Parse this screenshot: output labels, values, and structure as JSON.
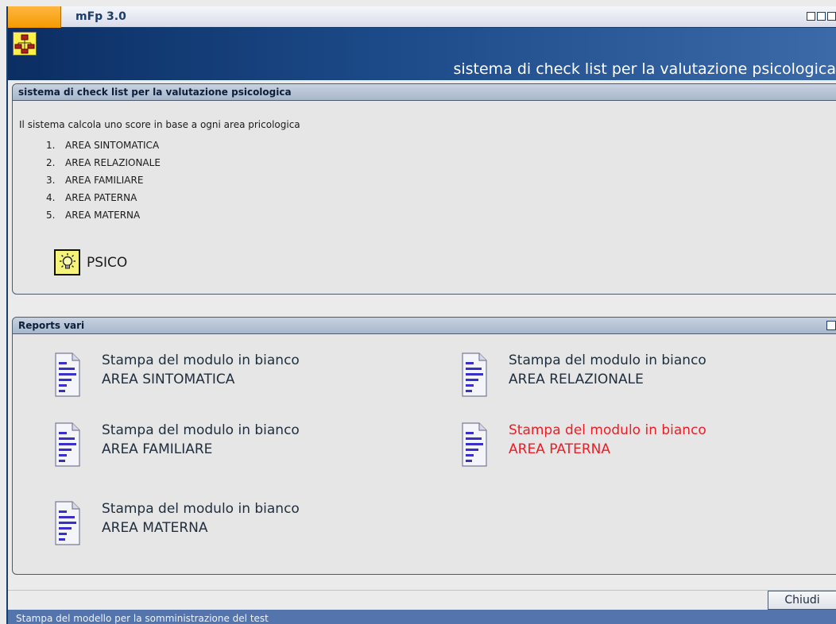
{
  "window": {
    "title": "mFp 3.0"
  },
  "banner": {
    "title": "sistema di check list per la valutazione psicologica"
  },
  "panel1": {
    "header": "sistema di check list per la valutazione psicologica",
    "intro": "Il sistema calcola uno score in base a ogni area pricologica",
    "areas": [
      {
        "num": "1.",
        "label": "AREA SINTOMATICA"
      },
      {
        "num": "2.",
        "label": "AREA RELAZIONALE"
      },
      {
        "num": "3.",
        "label": "AREA FAMILIARE"
      },
      {
        "num": "4.",
        "label": "AREA PATERNA"
      },
      {
        "num": "5.",
        "label": "AREA MATERNA"
      }
    ],
    "psico_label": "PSICO"
  },
  "panel2": {
    "header": "Reports vari",
    "reports": [
      {
        "line1": "Stampa del modulo in bianco",
        "line2": "AREA SINTOMATICA",
        "highlighted": false
      },
      {
        "line1": "Stampa del modulo in bianco",
        "line2": "AREA RELAZIONALE",
        "highlighted": false
      },
      {
        "line1": "Stampa del modulo in bianco",
        "line2": "AREA FAMILIARE",
        "highlighted": false
      },
      {
        "line1": "Stampa del modulo in bianco",
        "line2": "AREA PATERNA",
        "highlighted": true
      },
      {
        "line1": "Stampa del modulo in bianco",
        "line2": "AREA MATERNA",
        "highlighted": false
      }
    ]
  },
  "footer": {
    "close_label": "Chiudi"
  },
  "status": {
    "text": "Stampa del modello per la somministrazione del test"
  },
  "colors": {
    "highlight": "#ee1c24",
    "banner": "#0b2e63",
    "status": "#5474ad"
  }
}
